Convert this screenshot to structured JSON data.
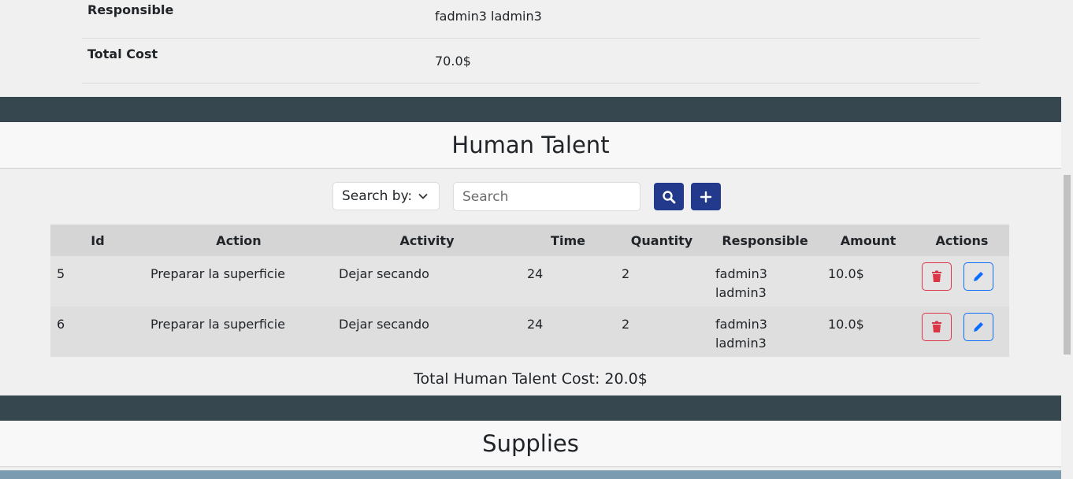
{
  "details": [
    {
      "label": "Responsible",
      "value": "fadmin3 ladmin3"
    },
    {
      "label": "Total Cost",
      "value": "70.0$"
    }
  ],
  "human_talent": {
    "title": "Human Talent",
    "search_by_label": "Search by:",
    "search_placeholder": "Search",
    "columns": [
      "Id",
      "Action",
      "Activity",
      "Time",
      "Quantity",
      "Responsible",
      "Amount",
      "Actions"
    ],
    "rows": [
      {
        "id": "5",
        "action": "Preparar la superficie",
        "activity": "Dejar secando",
        "time": "24",
        "quantity": "2",
        "responsible": "fadmin3 ladmin3",
        "amount": "10.0$"
      },
      {
        "id": "6",
        "action": "Preparar la superficie",
        "activity": "Dejar secando",
        "time": "24",
        "quantity": "2",
        "responsible": "fadmin3 ladmin3",
        "amount": "10.0$"
      }
    ],
    "total_label": "Total Human Talent Cost: 20.0$"
  },
  "supplies": {
    "title": "Supplies"
  },
  "icons": {
    "search": "search-icon",
    "add": "plus-icon",
    "delete": "trash-icon",
    "edit": "pencil-icon",
    "dropdown": "chevron-down-icon"
  },
  "colors": {
    "band": "#37474f",
    "primary_button": "#233a8c",
    "delete": "#dc3545",
    "edit": "#0d6efd"
  }
}
